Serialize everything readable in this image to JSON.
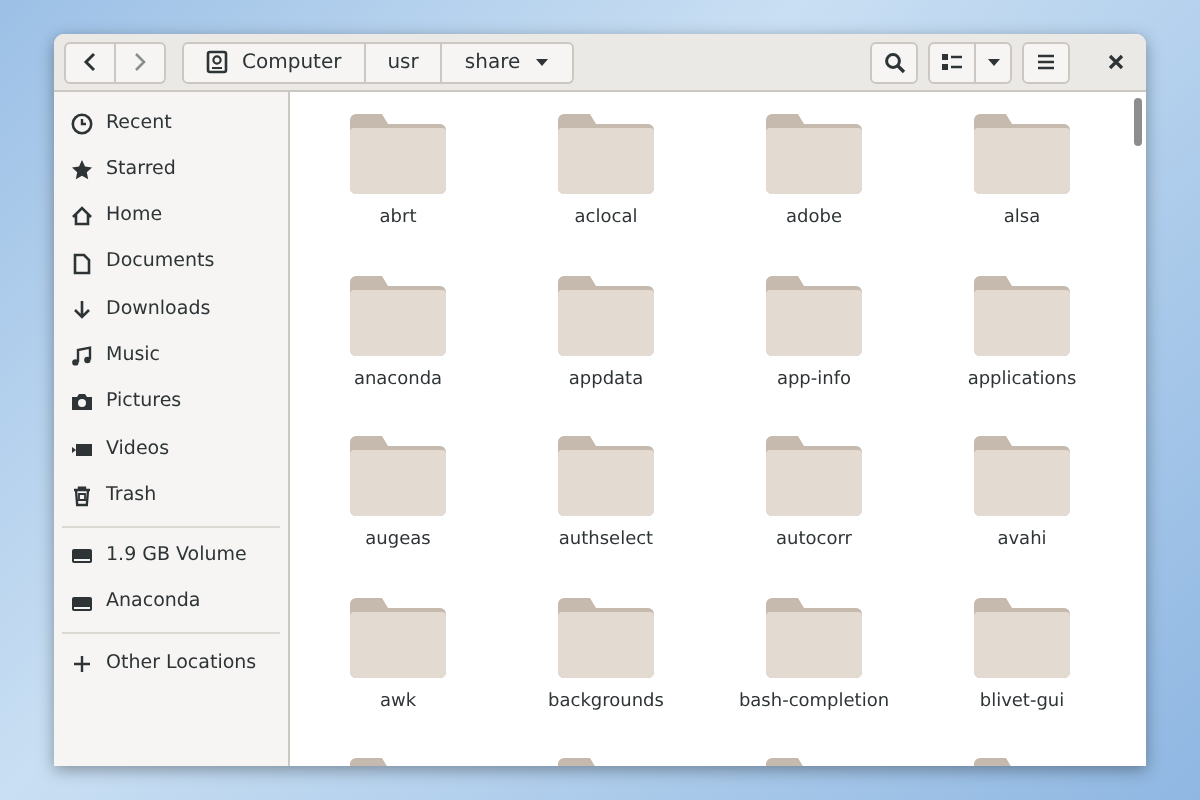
{
  "header": {
    "path": [
      {
        "label": "Computer",
        "kind": "drive"
      },
      {
        "label": "usr",
        "kind": "plain"
      },
      {
        "label": "share",
        "kind": "menu"
      }
    ]
  },
  "sidebar": {
    "sections": [
      {
        "items": [
          {
            "label": "Recent",
            "kind": "clock"
          },
          {
            "label": "Starred",
            "kind": "star"
          },
          {
            "label": "Home",
            "kind": "home"
          },
          {
            "label": "Documents",
            "kind": "document"
          },
          {
            "label": "Downloads",
            "kind": "download"
          },
          {
            "label": "Music",
            "kind": "music"
          },
          {
            "label": "Pictures",
            "kind": "camera"
          },
          {
            "label": "Videos",
            "kind": "video"
          },
          {
            "label": "Trash",
            "kind": "trash"
          }
        ]
      },
      {
        "items": [
          {
            "label": "1.9 GB Volume",
            "kind": "drive"
          },
          {
            "label": "Anaconda",
            "kind": "drive"
          }
        ]
      },
      {
        "items": [
          {
            "label": "Other Locations",
            "kind": "plus"
          }
        ]
      }
    ]
  },
  "folders": [
    {
      "label": "abrt"
    },
    {
      "label": "aclocal"
    },
    {
      "label": "adobe"
    },
    {
      "label": "alsa"
    },
    {
      "label": "anaconda"
    },
    {
      "label": "appdata"
    },
    {
      "label": "app-info"
    },
    {
      "label": "applications"
    },
    {
      "label": "augeas"
    },
    {
      "label": "authselect"
    },
    {
      "label": "autocorr"
    },
    {
      "label": "avahi"
    },
    {
      "label": "awk"
    },
    {
      "label": "backgrounds"
    },
    {
      "label": "bash-completion"
    },
    {
      "label": "blivet-gui"
    }
  ],
  "partial_row": [
    {
      "kind": "folder"
    },
    {
      "kind": "folder"
    },
    {
      "kind": "folder"
    },
    {
      "kind": "folder"
    }
  ]
}
